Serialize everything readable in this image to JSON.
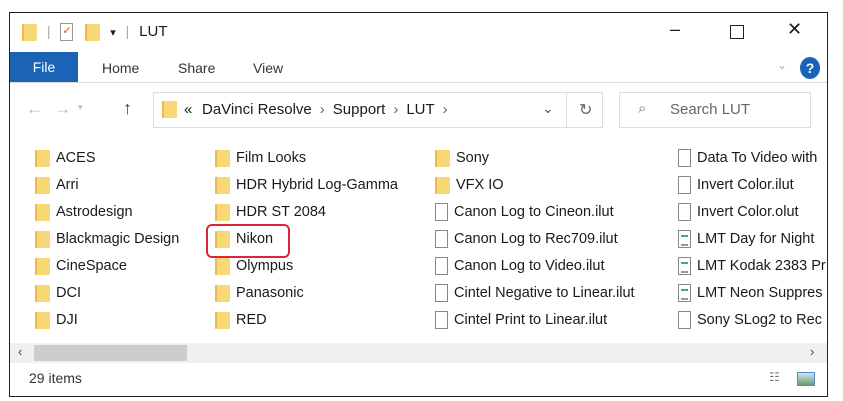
{
  "title": "LUT",
  "ribbon": {
    "file": "File",
    "tabs": [
      "Home",
      "Share",
      "View"
    ]
  },
  "address": {
    "overflow": "«",
    "crumbs": [
      "DaVinci Resolve",
      "Support",
      "LUT"
    ]
  },
  "search": {
    "placeholder": "Search LUT"
  },
  "items": [
    {
      "name": "ACES",
      "type": "folder"
    },
    {
      "name": "Arri",
      "type": "folder"
    },
    {
      "name": "Astrodesign",
      "type": "folder"
    },
    {
      "name": "Blackmagic Design",
      "type": "folder"
    },
    {
      "name": "CineSpace",
      "type": "folder"
    },
    {
      "name": "DCI",
      "type": "folder"
    },
    {
      "name": "DJI",
      "type": "folder"
    },
    {
      "name": "Film Looks",
      "type": "folder"
    },
    {
      "name": "HDR Hybrid Log-Gamma",
      "type": "folder"
    },
    {
      "name": "HDR ST 2084",
      "type": "folder"
    },
    {
      "name": "Nikon",
      "type": "folder"
    },
    {
      "name": "Olympus",
      "type": "folder"
    },
    {
      "name": "Panasonic",
      "type": "folder"
    },
    {
      "name": "RED",
      "type": "folder"
    },
    {
      "name": "Sony",
      "type": "folder"
    },
    {
      "name": "VFX IO",
      "type": "folder"
    },
    {
      "name": "Canon Log to Cineon.ilut",
      "type": "file"
    },
    {
      "name": "Canon Log to Rec709.ilut",
      "type": "file"
    },
    {
      "name": "Canon Log to Video.ilut",
      "type": "file"
    },
    {
      "name": "Cintel Negative to Linear.ilut",
      "type": "file"
    },
    {
      "name": "Cintel Print to Linear.ilut",
      "type": "file"
    },
    {
      "name": "Data To Video with",
      "type": "file"
    },
    {
      "name": "Invert Color.ilut",
      "type": "file"
    },
    {
      "name": "Invert Color.olut",
      "type": "file"
    },
    {
      "name": "LMT Day for Night",
      "type": "doc"
    },
    {
      "name": "LMT Kodak 2383 Pr",
      "type": "doc"
    },
    {
      "name": "LMT Neon Suppres",
      "type": "doc"
    },
    {
      "name": "Sony SLog2 to Rec",
      "type": "file"
    }
  ],
  "highlighted": "Nikon",
  "status": {
    "count": "29 items"
  },
  "colors": {
    "accent": "#1a63b5",
    "highlight": "#d8263b"
  }
}
